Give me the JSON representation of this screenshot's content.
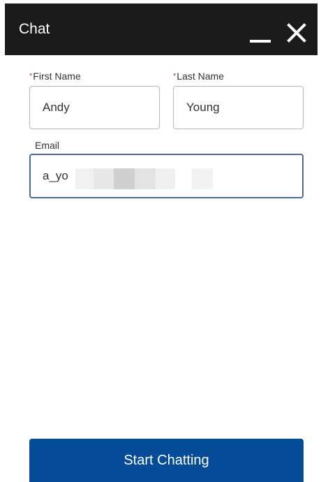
{
  "header": {
    "title": "Chat",
    "minimize_icon": "minimize-icon",
    "close_icon": "close-icon"
  },
  "form": {
    "first_name": {
      "required_marker": "*",
      "label": "First Name",
      "value": "Andy"
    },
    "last_name": {
      "required_marker": "*",
      "label": "Last Name",
      "value": "Young"
    },
    "email": {
      "label": "Email",
      "value": "a_yo"
    }
  },
  "actions": {
    "start_label": "Start Chatting"
  },
  "colors": {
    "header_bg": "#1b1b1b",
    "button_bg": "#044c98",
    "required": "#c23934",
    "focus_border": "#4a6a95"
  }
}
